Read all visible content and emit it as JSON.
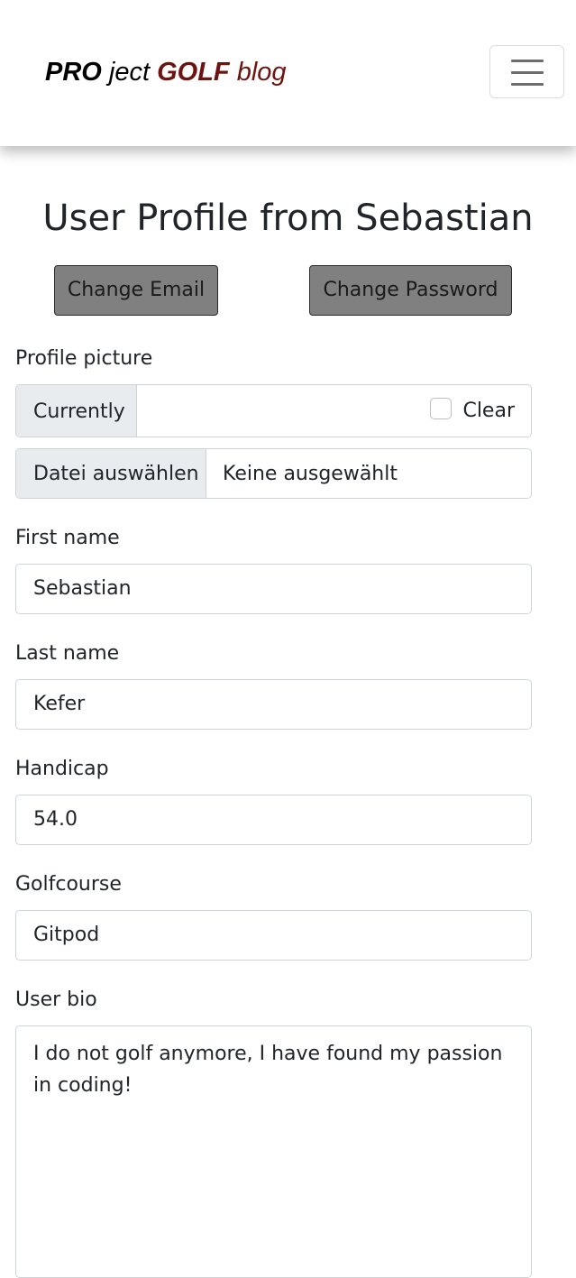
{
  "navbar": {
    "brand": {
      "part1": "PRO",
      "part2": " ject ",
      "part3": "GOLF",
      "part4": " blog"
    },
    "toggler_icon": "hamburger-menu-icon"
  },
  "page": {
    "title": "User Profile from Sebastian"
  },
  "actions": {
    "change_email": "Change Email",
    "change_password": "Change Password"
  },
  "form": {
    "profile_picture": {
      "label": "Profile picture",
      "currently_label": "Currently",
      "clear_label": "Clear",
      "clear_checked": false,
      "file_button": "Datei auswählen",
      "file_status": "Keine ausgewählt"
    },
    "first_name": {
      "label": "First name",
      "value": "Sebastian"
    },
    "last_name": {
      "label": "Last name",
      "value": "Kefer"
    },
    "handicap": {
      "label": "Handicap",
      "value": "54.0"
    },
    "golfcourse": {
      "label": "Golfcourse",
      "value": "Gitpod"
    },
    "user_bio": {
      "label": "User bio",
      "value": "I do not golf anymore, I have found my passion in coding!"
    }
  },
  "colors": {
    "brand_accent": "#6e1410",
    "button_bg": "#808080",
    "addon_bg": "#e9ecef",
    "border": "#ced4da"
  }
}
